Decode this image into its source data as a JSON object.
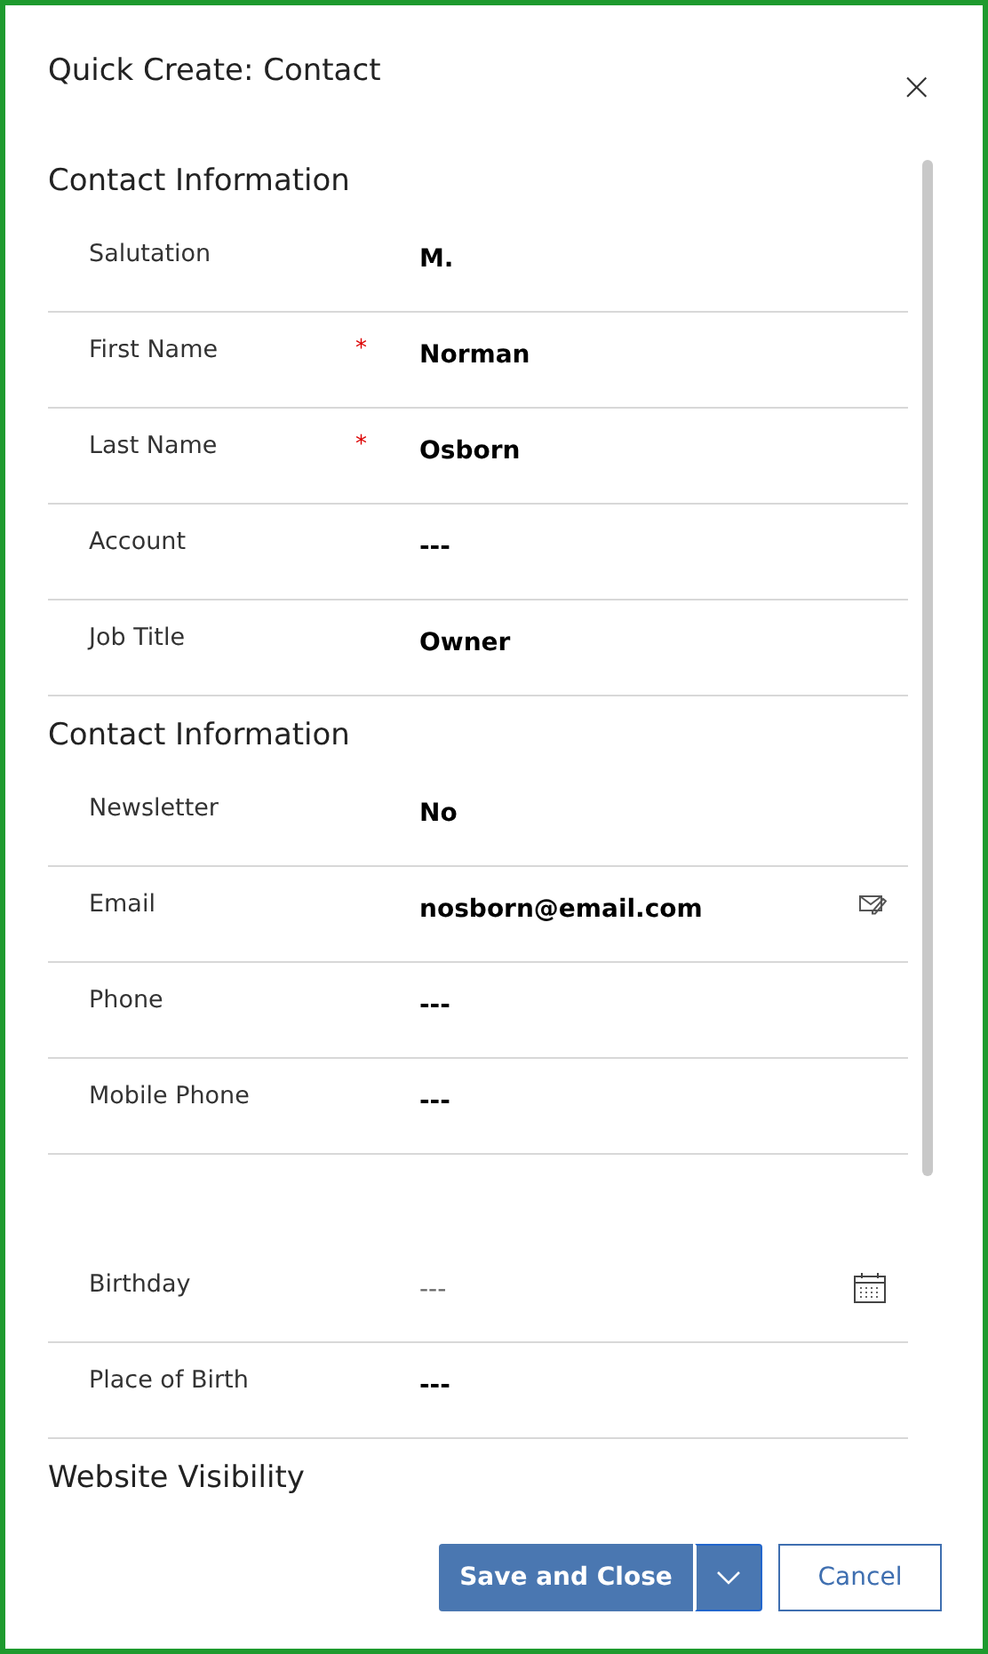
{
  "dialog": {
    "title": "Quick Create: Contact",
    "close": "×"
  },
  "sections": [
    {
      "title": "Contact Information",
      "fields": [
        {
          "label": "Salutation",
          "value": "M.",
          "kind": "text"
        },
        {
          "label": "First Name",
          "required_mark": "*",
          "value": "Norman",
          "kind": "text"
        },
        {
          "label": "Last Name",
          "required_mark": "*",
          "value": "Osborn",
          "kind": "text"
        },
        {
          "label": "Account",
          "value": "---",
          "kind": "text"
        },
        {
          "label": "Job Title",
          "value": "Owner",
          "kind": "text"
        }
      ]
    },
    {
      "title": "Contact Information",
      "fields": [
        {
          "label": "Newsletter",
          "value": "No",
          "kind": "text"
        },
        {
          "label": "Email",
          "value": "nosborn@email.com",
          "kind": "email"
        },
        {
          "label": "Phone",
          "value": "---",
          "kind": "text"
        },
        {
          "label": "Mobile Phone",
          "value": "---",
          "kind": "text"
        },
        {
          "label": "Birthday",
          "placeholder": "---",
          "kind": "date"
        },
        {
          "label": "Place of Birth",
          "value": "---",
          "kind": "text"
        }
      ]
    },
    {
      "title": "Website Visibility"
    }
  ],
  "buttons": {
    "save": "Save and Close",
    "cancel": "Cancel"
  }
}
